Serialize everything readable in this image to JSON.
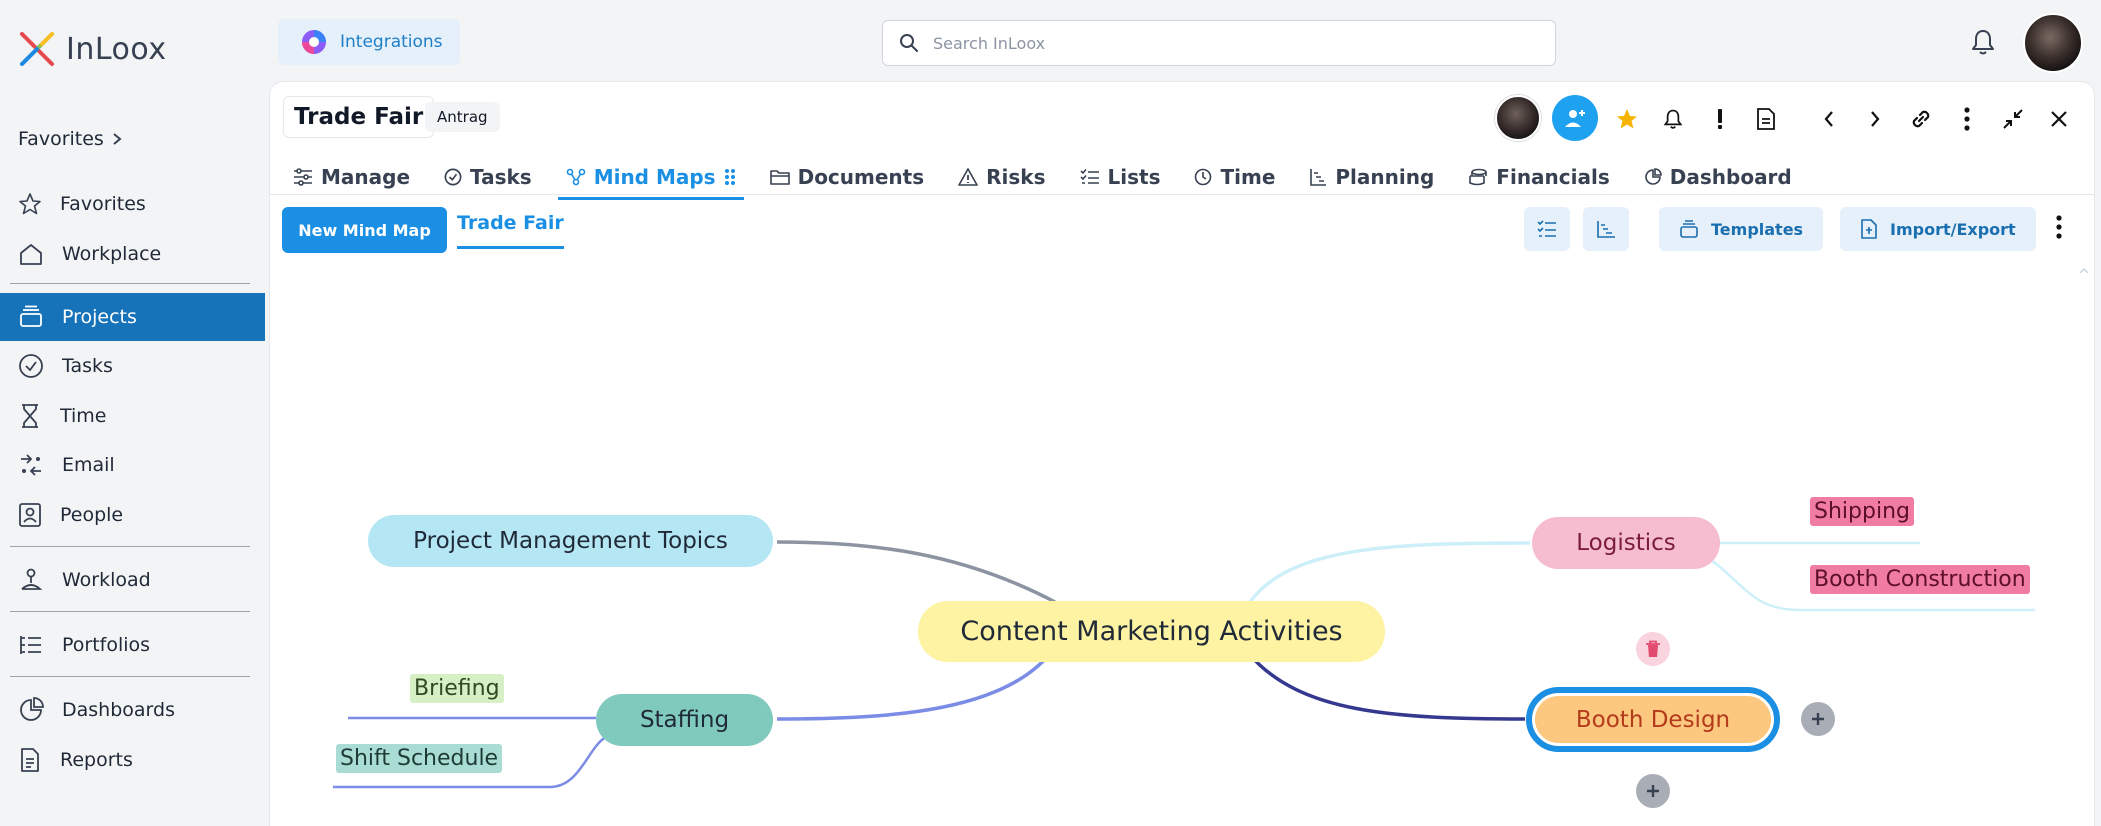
{
  "app": {
    "logo_text": "InLoox",
    "integrations_label": "Integrations",
    "search_placeholder": "Search InLoox"
  },
  "sidebar": {
    "favorites_header": "Favorites",
    "items": [
      {
        "label": "Favorites",
        "icon": "star-icon"
      },
      {
        "label": "Workplace",
        "icon": "home-icon"
      },
      {
        "label": "Projects",
        "icon": "projects-icon",
        "active": true
      },
      {
        "label": "Tasks",
        "icon": "check-circle-icon"
      },
      {
        "label": "Time",
        "icon": "hourglass-icon"
      },
      {
        "label": "Email",
        "icon": "email-icon"
      },
      {
        "label": "People",
        "icon": "person-card-icon"
      },
      {
        "label": "Workload",
        "icon": "workload-icon"
      },
      {
        "label": "Portfolios",
        "icon": "portfolio-list-icon"
      },
      {
        "label": "Dashboards",
        "icon": "dashboard-icon"
      },
      {
        "label": "Reports",
        "icon": "report-icon"
      }
    ]
  },
  "project": {
    "title": "Trade Fair",
    "status": "Antrag"
  },
  "tabs": [
    {
      "label": "Manage",
      "icon": "sliders-icon"
    },
    {
      "label": "Tasks",
      "icon": "check-circle-icon"
    },
    {
      "label": "Mind Maps",
      "icon": "mindmap-icon",
      "active": true
    },
    {
      "label": "Documents",
      "icon": "folder-icon"
    },
    {
      "label": "Risks",
      "icon": "warning-icon"
    },
    {
      "label": "Lists",
      "icon": "list-icon"
    },
    {
      "label": "Time",
      "icon": "clock-icon"
    },
    {
      "label": "Planning",
      "icon": "gantt-icon"
    },
    {
      "label": "Financials",
      "icon": "coins-icon"
    },
    {
      "label": "Dashboard",
      "icon": "pie-chart-icon"
    }
  ],
  "toolbar": {
    "new_button": "New Mind Map",
    "active_map": "Trade Fair",
    "templates_label": "Templates",
    "import_export_label": "Import/Export"
  },
  "mindmap": {
    "center": "Content Marketing Activities",
    "nodes": {
      "pm_topics": "Project Management Topics",
      "staffing": "Staffing",
      "briefing": "Briefing",
      "shift_schedule": "Shift Schedule",
      "logistics": "Logistics",
      "shipping": "Shipping",
      "booth_construction": "Booth Construction",
      "booth_design": "Booth Design"
    }
  },
  "colors": {
    "accent": "#1a8fe3",
    "sidebar_active": "#1672b9",
    "center_node": "#fdf3a3",
    "pm_node": "#b5e6f3",
    "staffing_node": "#7fcabd",
    "logistics_node": "#f6bcd0",
    "booth_design_node": "#fcc77f",
    "leaf_pink": "#f07ca3",
    "leaf_green": "#d7efc4",
    "leaf_teal": "#a9dcd3"
  }
}
